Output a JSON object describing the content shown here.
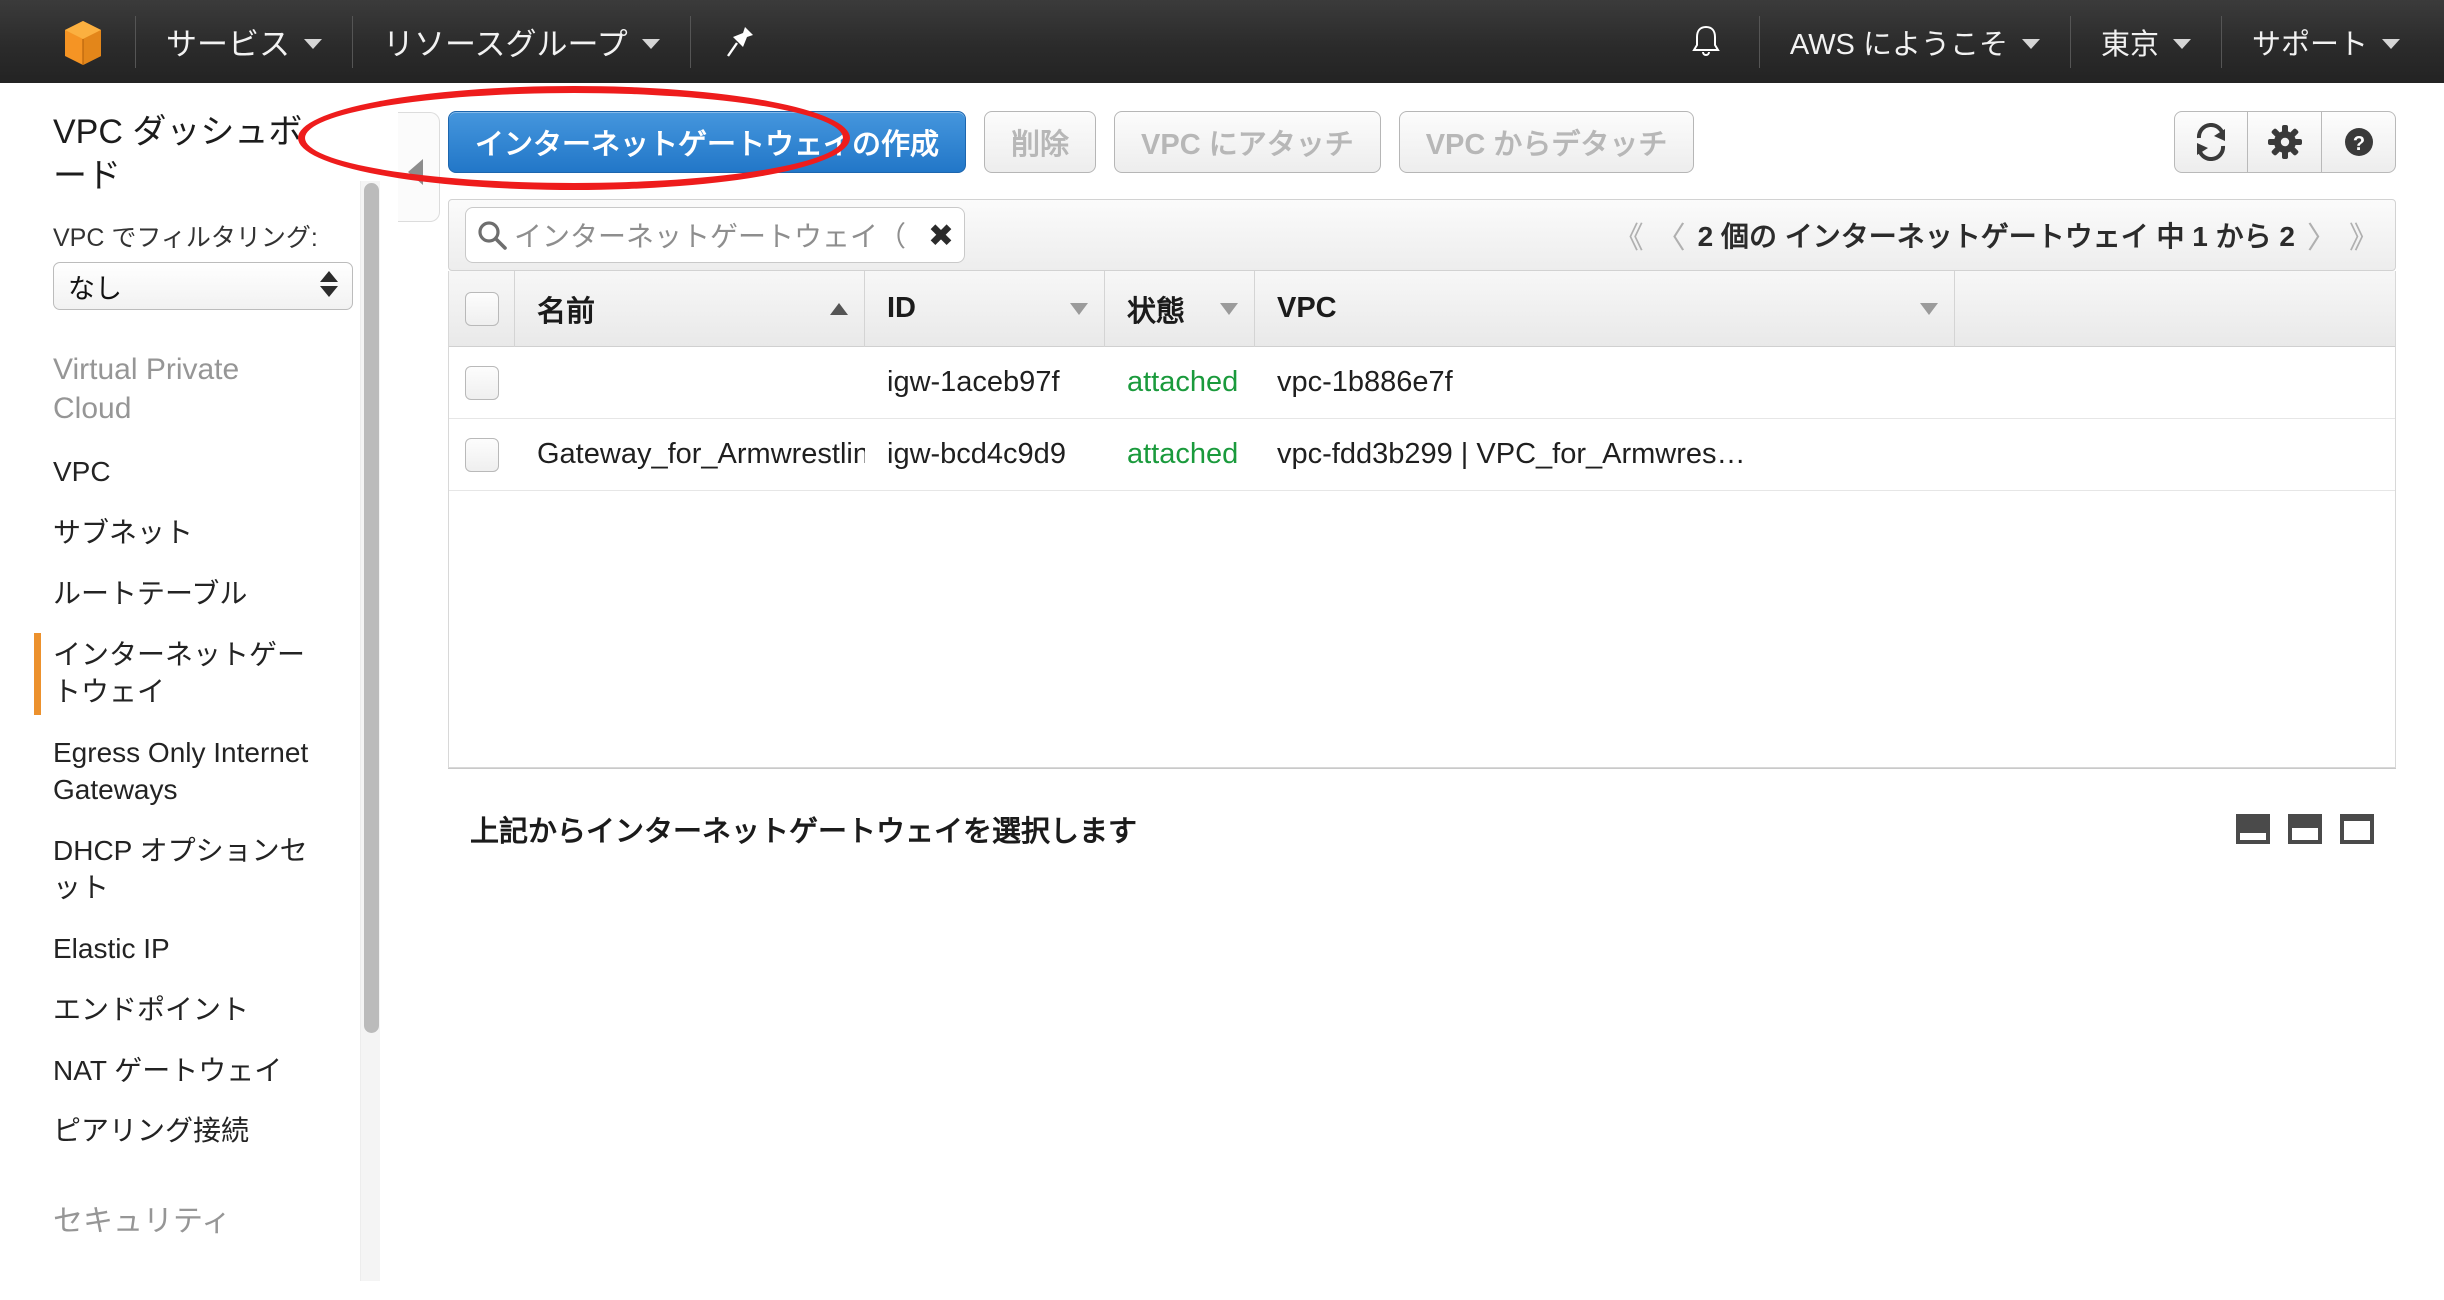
{
  "topnav": {
    "logo_name": "aws-cube-logo",
    "services_label": "サービス",
    "resource_groups_label": "リソースグループ",
    "pin_label": "ピン",
    "bell_label": "通知",
    "account_label": "AWS にようこそ",
    "region_label": "東京",
    "support_label": "サポート"
  },
  "sidebar": {
    "title": "VPC ダッシュボード",
    "filter_label": "VPC でフィルタリング:",
    "filter_value": "なし",
    "section_vpc": "Virtual Private Cloud",
    "section_security": "セキュリティ",
    "items": [
      {
        "label": "VPC",
        "active": false
      },
      {
        "label": "サブネット",
        "active": false
      },
      {
        "label": "ルートテーブル",
        "active": false
      },
      {
        "label": "インターネットゲートウェイ",
        "active": true
      },
      {
        "label": "Egress Only Internet Gateways",
        "active": false
      },
      {
        "label": "DHCP オプションセット",
        "active": false
      },
      {
        "label": "Elastic IP",
        "active": false
      },
      {
        "label": "エンドポイント",
        "active": false
      },
      {
        "label": "NAT ゲートウェイ",
        "active": false
      },
      {
        "label": "ピアリング接続",
        "active": false
      }
    ]
  },
  "toolbar": {
    "create_label": "インターネットゲートウェイの作成",
    "delete_label": "削除",
    "attach_label": "VPC にアタッチ",
    "detach_label": "VPC からデタッチ",
    "refresh_icon": "refresh-icon",
    "settings_icon": "gear-icon",
    "help_icon": "help-icon"
  },
  "filterbar": {
    "search_placeholder": "インターネットゲートウェイ（",
    "clear_label": "✖",
    "pager": {
      "first": "《",
      "prev": "〈",
      "text": "2 個の インターネットゲートウェイ 中 1 から 2",
      "next": "〉",
      "last": "》"
    }
  },
  "table": {
    "columns": [
      {
        "label": "名前",
        "sort": "asc"
      },
      {
        "label": "ID",
        "sort": "none"
      },
      {
        "label": "状態",
        "sort": "none"
      },
      {
        "label": "VPC",
        "sort": "none"
      }
    ],
    "rows": [
      {
        "name": "",
        "id": "igw-1aceb97f",
        "state": "attached",
        "vpc": "vpc-1b886e7f"
      },
      {
        "name": "Gateway_for_Armwrestling-Map",
        "id": "igw-bcd4c9d9",
        "state": "attached",
        "vpc": "vpc-fdd3b299 | VPC_for_Armwres…"
      }
    ]
  },
  "detail": {
    "message": "上記からインターネットゲートウェイを選択します"
  },
  "colors": {
    "primary_button": "#2277c8",
    "accent": "#ec912d",
    "state_text": "#1a9a3c",
    "annotation": "#ee1c1c",
    "navbar": "#2b2b2b"
  }
}
